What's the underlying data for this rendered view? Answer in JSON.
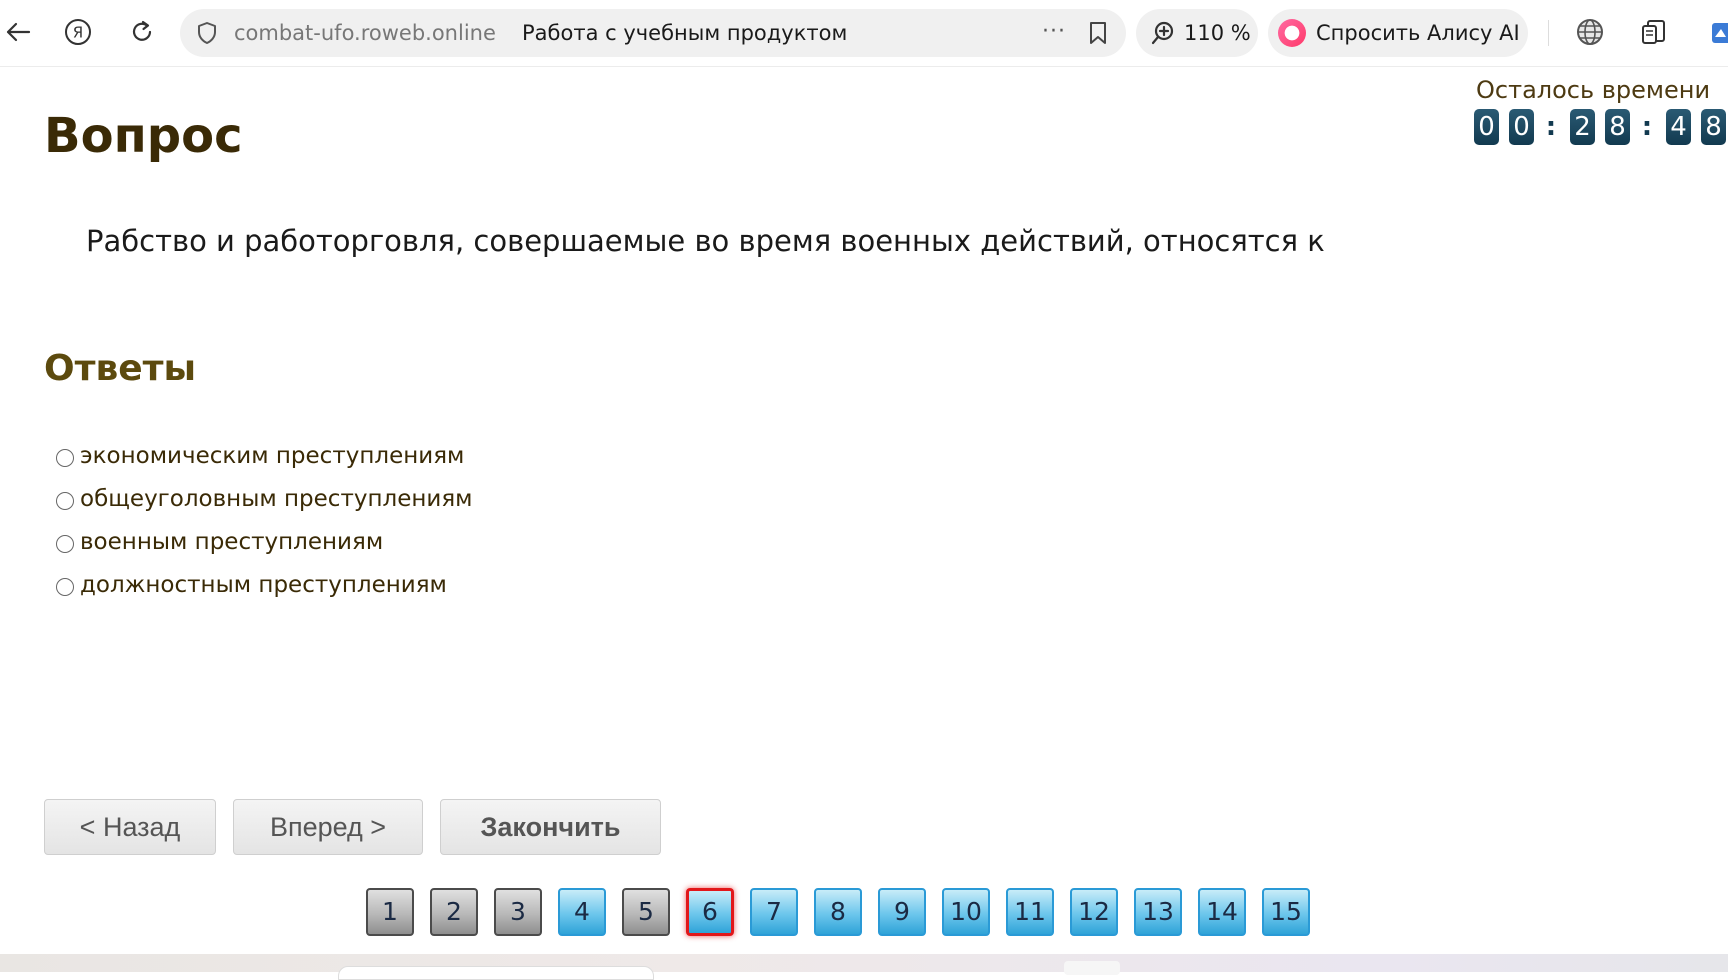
{
  "browser": {
    "host": "combat-ufo.roweb.online",
    "page_title": "Работа с учебным продуктом",
    "menu_dots": "···",
    "zoom": "110 %",
    "alice_label": "Спросить Алису AI"
  },
  "timer": {
    "label": "Осталось времени",
    "digits": [
      "0",
      "0",
      "2",
      "8",
      "4",
      "8"
    ],
    "separator": ":"
  },
  "question": {
    "heading": "Вопрос",
    "text": "Рабство и работорговля, совершаемые во время военных действий, относятся к"
  },
  "answers": {
    "heading": "Ответы",
    "options": [
      "экономическим преступлениям",
      "общеуголовным преступлениям",
      "военным преступлениям",
      "должностным преступлениям"
    ]
  },
  "nav": {
    "back": "< Назад",
    "next": "Вперед >",
    "finish": "Закончить"
  },
  "pager": {
    "pages": [
      "1",
      "2",
      "3",
      "4",
      "5",
      "6",
      "7",
      "8",
      "9",
      "10",
      "11",
      "12",
      "13",
      "14",
      "15"
    ],
    "current": "6",
    "colors": {
      "done": "#8e8e8e",
      "todo": "#2fa3d8",
      "current_border": "#e2171a"
    }
  }
}
